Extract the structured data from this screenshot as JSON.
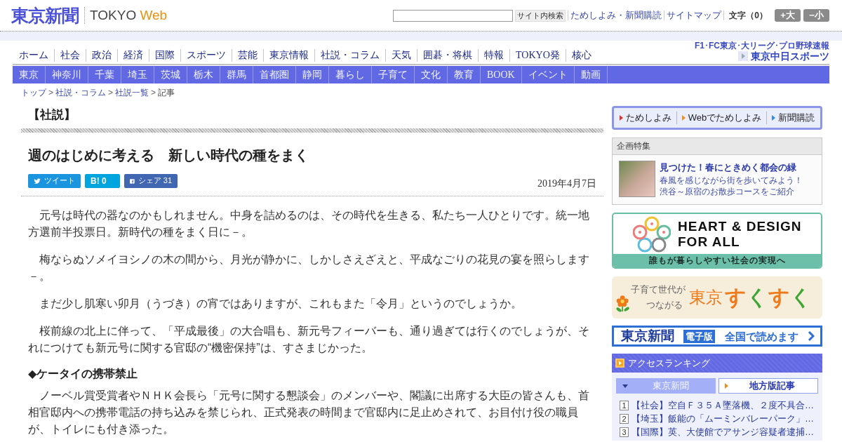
{
  "header": {
    "logo": "東京新聞",
    "brand_main": "TOKYO",
    "brand_accent": "Web",
    "search": {
      "button": "サイト内検索"
    },
    "links": [
      "ためしよみ・新聞購読",
      "サイトマップ"
    ],
    "font_size": {
      "label": "文字（0）",
      "buttons": [
        "+大",
        "−小"
      ]
    }
  },
  "main_nav": [
    "ホーム",
    "社会",
    "政治",
    "経済",
    "国際",
    "スポーツ",
    "芸能",
    "東京情報",
    "社説・コラム",
    "天気",
    "囲碁・将棋",
    "特報",
    "TOKYO発",
    "核心"
  ],
  "sports_link": {
    "caption": "F1･FC東京･大リーグ･プロ野球速報",
    "logo": "東京中日スポーツ"
  },
  "region_nav": [
    "東京",
    "神奈川",
    "千葉",
    "埼玉",
    "茨城",
    "栃木",
    "群馬",
    "首都圏",
    "静岡",
    "暮らし",
    "子育て",
    "文化",
    "教育",
    "BOOK",
    "イベント",
    "動画"
  ],
  "breadcrumb": [
    {
      "label": "トップ",
      "current": false,
      "separator": ">"
    },
    {
      "label": "社説・コラム",
      "current": false,
      "separator": ">"
    },
    {
      "label": "社説一覧",
      "current": false,
      "separator": ">"
    },
    {
      "label": "記事",
      "current": true
    }
  ],
  "article": {
    "category": "【社説】",
    "title": "週のはじめに考える　新しい時代の種をまく",
    "share": [
      {
        "kind": "twitter",
        "label": "ツイート"
      },
      {
        "kind": "hatena",
        "label": "B!",
        "count": "0"
      },
      {
        "kind": "facebook",
        "label": "シェア",
        "count": "31"
      }
    ],
    "date": "2019年4月7日",
    "body": [
      {
        "kind": "paragraph",
        "text": "元号は時代の器なのかもしれません。中身を詰めるのは、その時代を生きる、私たち一人ひとりです。統一地方選前半投票日。新時代の種をまく日に－。"
      },
      {
        "kind": "paragraph",
        "text": "梅ならぬソメイヨシノの木の間から、月光が静かに、しかしさえざえと、平成なごりの花見の宴を照らします－。"
      },
      {
        "kind": "paragraph",
        "text": "まだ少し肌寒い卯月（うづき）の宵ではありますが、これもまた「令月」というのでしょうか。"
      },
      {
        "kind": "paragraph",
        "text": "桜前線の北上に伴って、「平成最後」の大合唱も、新元号フィーバーも、通り過ぎては行くのでしょうが、それにつけても新元号に関する官邸の“機密保持”は、すさまじかった。"
      },
      {
        "kind": "heading",
        "text": "◆ケータイの携帯禁止"
      },
      {
        "kind": "paragraph",
        "text": "ノーベル賞受賞者やＮＨＫ会長ら「元号に関する懇談会」のメンバーや、閣議に出席する大臣の皆さんも、首相官邸内への携帯電話の持ち込みを禁じられ、正式発表の時間まで官邸内に足止めされて、お目付け役の職員が、トイレにも付き添った。"
      }
    ]
  },
  "sidebar": {
    "trial_links": [
      {
        "label": "ためしよみ",
        "color": "#e8332a"
      },
      {
        "label": "Webでためしよみ",
        "color": "#f0901e"
      },
      {
        "label": "新聞購読",
        "color": "#2f8ae0"
      }
    ],
    "feature": {
      "heading": "企画特集",
      "title": "見つけた！春にときめく都会の緑",
      "description_lines": [
        "春風を感じながら街を歩いてみよう！",
        "渋谷～原宿のお散歩コースをご紹介"
      ]
    },
    "banners": [
      {
        "kind": "heart_design",
        "title_lines": [
          "HEART & DESIGN",
          "FOR ALL"
        ],
        "tagline": "誰もが暮らしやすい社会の実現へ"
      },
      {
        "kind": "sukusuku",
        "lead_lines": [
          "子育て世代が",
          "つながる"
        ],
        "place": "東京",
        "name": "すくすく"
      },
      {
        "kind": "digital",
        "logo": "東京新聞",
        "badge": "電子版",
        "text": "全国で読めます"
      }
    ],
    "ranking": {
      "title": "アクセスランキング",
      "tabs": [
        {
          "label": "東京新聞",
          "selected": true
        },
        {
          "label": "地方版記事",
          "selected": false
        }
      ],
      "items": [
        {
          "rank": "1",
          "text": "【社会】空自Ｆ３５Ａ墜落機、２度不具合…"
        },
        {
          "rank": "2",
          "text": "【埼玉】飯能の「ムーミンバレーパーク」…"
        },
        {
          "rank": "3",
          "text": "【国際】英、大使館でアサンジ容疑者逮捕…"
        }
      ]
    }
  }
}
